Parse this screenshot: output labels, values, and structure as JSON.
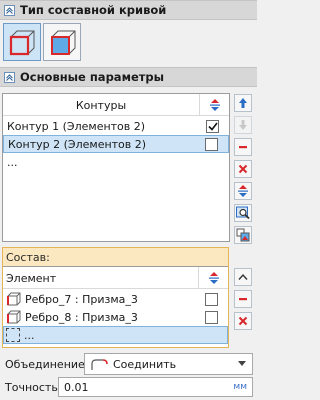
{
  "section_curve_type": {
    "title": "Тип составной кривой"
  },
  "section_main": {
    "title": "Основные параметры"
  },
  "contours": {
    "header": "Контуры",
    "rows": [
      {
        "label": "Контур 1 (Элементов 2)",
        "checked": true
      },
      {
        "label": "Контур 2 (Элементов 2)",
        "checked": false
      }
    ],
    "more": "..."
  },
  "composition": {
    "title": "Состав:",
    "header": "Элемент",
    "rows": [
      {
        "label": "Ребро_7 : Призма_3",
        "checked": false
      },
      {
        "label": "Ребро_8 : Призма_3",
        "checked": false
      }
    ],
    "more": "..."
  },
  "union": {
    "label": "Объединение:",
    "value": "Соединить"
  },
  "accuracy": {
    "label": "Точность:",
    "value": "0.01",
    "unit": "мм"
  },
  "colors": {
    "accent_red": "#d8282b",
    "accent_blue": "#2b6cc4",
    "selection": "#cfe5f7",
    "group_border": "#e5b457"
  }
}
